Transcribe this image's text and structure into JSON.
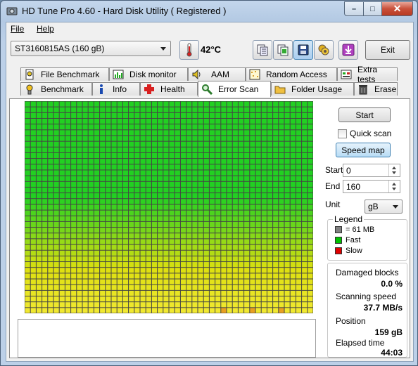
{
  "window": {
    "title": "HD Tune Pro 4.60 - Hard Disk Utility (  Registered )",
    "caption_buttons": {
      "minimize": "–",
      "maximize": "□",
      "close": "✕"
    }
  },
  "menu": {
    "file": "File",
    "help": "Help"
  },
  "toolbar": {
    "drive": "ST3160815AS (160 gB)",
    "temperature": "42°C",
    "exit_label": "Exit",
    "icons": [
      "thermometer-icon",
      "copy-info-icon",
      "copy-text-icon",
      "save-icon",
      "screenshot-icon",
      "download-icon"
    ]
  },
  "tabs": {
    "row_back": [
      {
        "label": "File Benchmark",
        "icon": "file-benchmark-icon"
      },
      {
        "label": "Disk monitor",
        "icon": "disk-monitor-icon"
      },
      {
        "label": "AAM",
        "icon": "speaker-icon"
      },
      {
        "label": "Random Access",
        "icon": "random-access-icon"
      },
      {
        "label": "Extra tests",
        "icon": "extra-tests-icon"
      }
    ],
    "row_front": [
      {
        "label": "Benchmark",
        "icon": "benchmark-icon"
      },
      {
        "label": "Info",
        "icon": "info-icon"
      },
      {
        "label": "Health",
        "icon": "health-icon"
      },
      {
        "label": "Error Scan",
        "icon": "magnifier-icon",
        "active": true
      },
      {
        "label": "Folder Usage",
        "icon": "folder-icon"
      },
      {
        "label": "Erase",
        "icon": "trash-icon"
      }
    ]
  },
  "scan": {
    "start_button": "Start",
    "quick_scan_label": "Quick scan",
    "quick_scan_checked": false,
    "speed_map_button": "Speed map",
    "start_label": "Start",
    "start_value": "0",
    "end_label": "End",
    "end_value": "160",
    "unit_label": "Unit",
    "unit_value": "gB"
  },
  "legend": {
    "title": "Legend",
    "block_size": "= 61 MB",
    "fast": "Fast",
    "slow": "Slow",
    "colors": {
      "block": "#808080",
      "fast": "#00c000",
      "slow": "#e00000"
    }
  },
  "stats": {
    "damaged_label": "Damaged blocks",
    "damaged_value": "0.0 %",
    "speed_label": "Scanning speed",
    "speed_value": "37.7 MB/s",
    "position_label": "Position",
    "position_value": "159 gB",
    "elapsed_label": "Elapsed time",
    "elapsed_value": "44:03"
  },
  "block_map": {
    "columns": 50,
    "rows": 37,
    "colors": {
      "fast": "#22d022",
      "transition": "#dde010",
      "slow_end": "#f0e830",
      "orange": "#e8a020",
      "grid": "#444444"
    }
  }
}
